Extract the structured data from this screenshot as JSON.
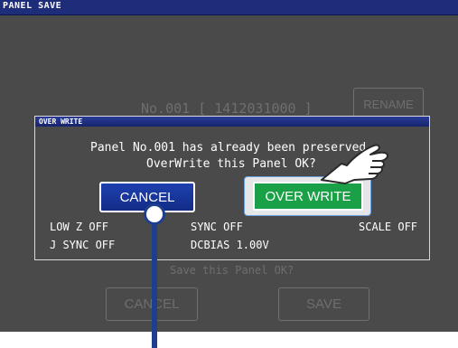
{
  "window": {
    "title": "PANEL SAVE"
  },
  "background_panel": {
    "panel_label": "No.001 [ 1412031000 ]",
    "rename_label": "RENAME",
    "prompt": "Save this Panel OK?",
    "cancel_label": "CANCEL",
    "save_label": "SAVE"
  },
  "dialog": {
    "title": "OVER WRITE",
    "message_line1": "Panel No.001 has already been preserved.",
    "message_line2": "OverWrite this Panel OK?",
    "cancel_label": "CANCEL",
    "overwrite_label": "OVER WRITE"
  },
  "settings": {
    "low_z": "LOW Z  OFF",
    "sync": "SYNC   OFF",
    "scale": "SCALE  OFF",
    "j_sync": "J SYNC OFF",
    "dcbias": "DCBIAS 1.00V"
  },
  "colors": {
    "titlebar": "#1d2d7a",
    "screen_bg": "#4a4a4a",
    "cancel_button": "#1a3aa0",
    "overwrite_button": "#1aa046",
    "pointer": "#1d3f8e"
  },
  "icons": {
    "hand": "pointing-hand-icon"
  }
}
